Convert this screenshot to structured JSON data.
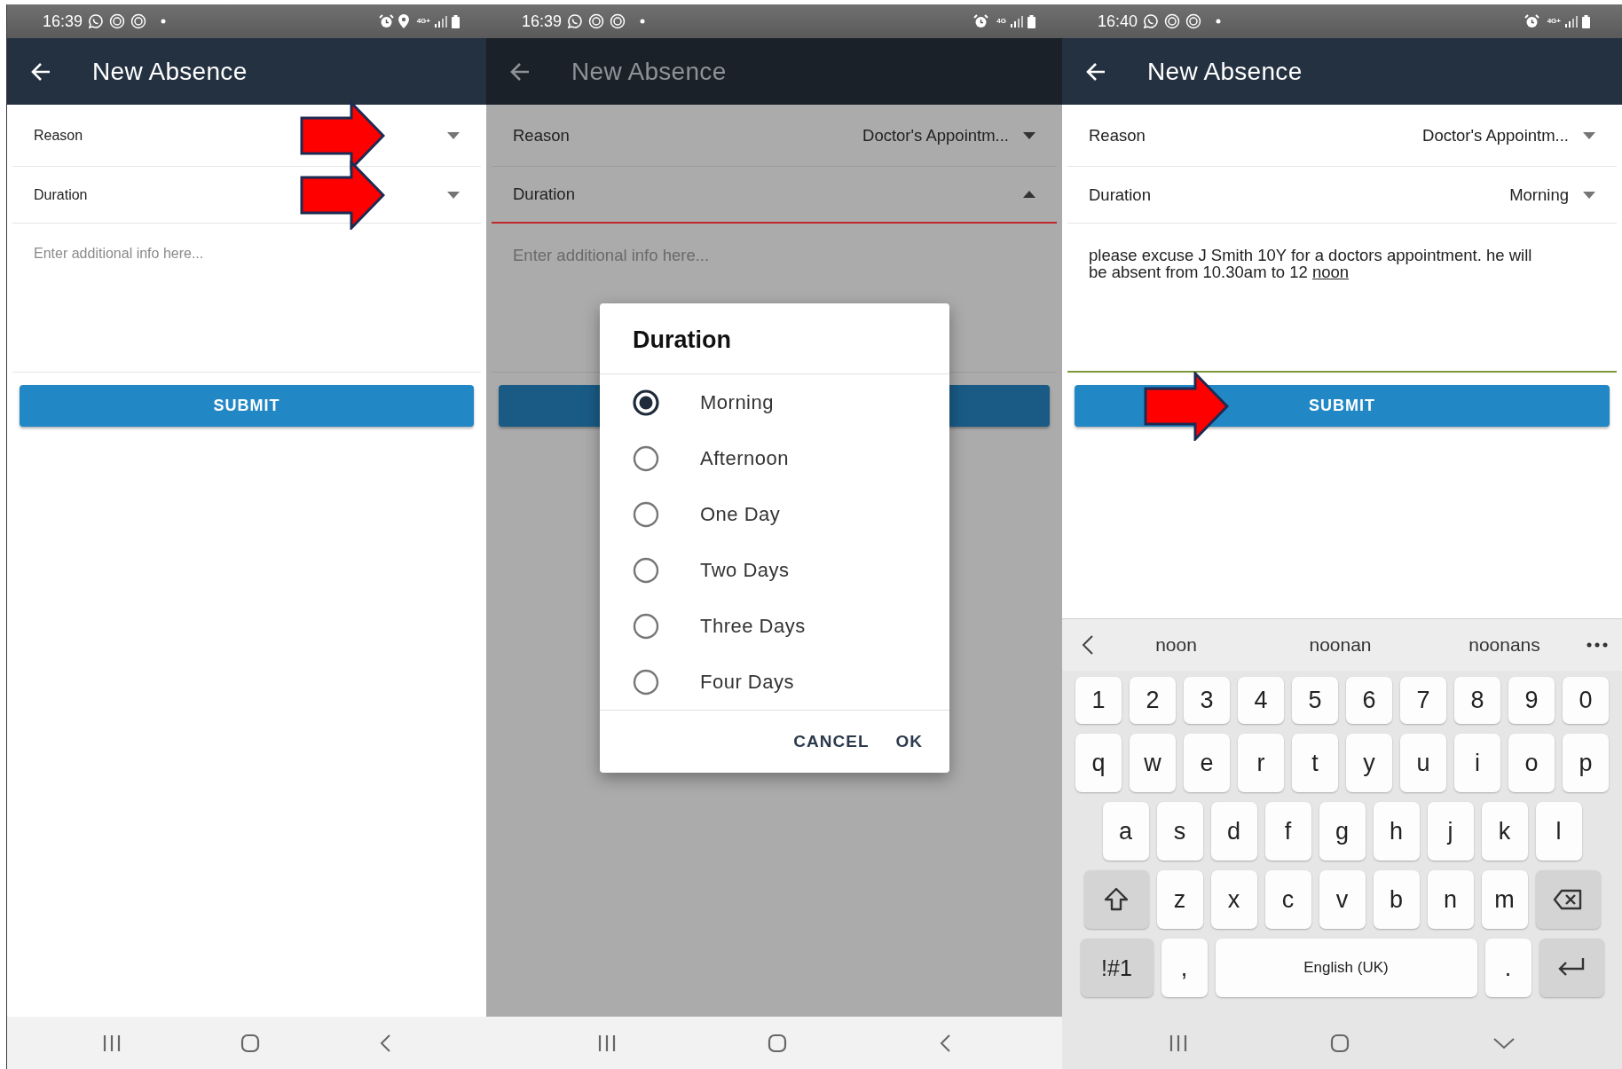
{
  "panels": [
    {
      "status_bar": {
        "time": "16:39",
        "location": true,
        "network": "4G+"
      },
      "header": {
        "title": "New Absence"
      },
      "fields": [
        {
          "label": "Reason",
          "expanded": false,
          "annotated": true
        },
        {
          "label": "Duration",
          "expanded": false,
          "annotated": true
        }
      ],
      "notes": {
        "placeholder": "Enter additional info here...",
        "focused": false
      },
      "submit": {
        "label": "SUBMIT",
        "annotated": false
      },
      "nav_bar": {
        "kind": "back"
      }
    },
    {
      "status_bar": {
        "time": "16:39",
        "location": false,
        "network": "4G"
      },
      "header": {
        "title": "New Absence"
      },
      "fields": [
        {
          "label": "Reason",
          "value": "Doctor's Appointm...",
          "expanded": false,
          "annotated": false
        },
        {
          "label": "Duration",
          "expanded": true,
          "annotated": false
        }
      ],
      "notes": {
        "placeholder": "Enter additional info here...",
        "focused": false
      },
      "submit": {
        "annotated": false
      },
      "dialog": {
        "title": "Duration",
        "options": [
          {
            "label": "Morning",
            "selected": true
          },
          {
            "label": "Afternoon",
            "selected": false
          },
          {
            "label": "One Day",
            "selected": false
          },
          {
            "label": "Two Days",
            "selected": false
          },
          {
            "label": "Three Days",
            "selected": false
          },
          {
            "label": "Four Days",
            "selected": false
          }
        ],
        "buttons": [
          "CANCEL",
          "OK"
        ]
      },
      "nav_bar": {
        "kind": "back"
      }
    },
    {
      "status_bar": {
        "time": "16:40",
        "location": false,
        "network": "4G+"
      },
      "header": {
        "title": "New Absence"
      },
      "fields": [
        {
          "label": "Reason",
          "value": "Doctor's Appointm...",
          "expanded": false,
          "annotated": false
        },
        {
          "label": "Duration",
          "value": "Morning",
          "expanded": false,
          "annotated": false
        }
      ],
      "notes": {
        "value": "please excuse J Smith 10Y for a doctors appointment. he will be absent from 10.30am to 12",
        "composing": "noon",
        "focused": true
      },
      "submit": {
        "label": "SUBMIT",
        "annotated": true
      },
      "keyboard": {
        "suggestions": [
          "noon",
          "noonan",
          "noonans"
        ],
        "rows": [
          {
            "keys": [
              {
                "kind": "char",
                "label": "1"
              },
              {
                "kind": "char",
                "label": "2"
              },
              {
                "kind": "char",
                "label": "3"
              },
              {
                "kind": "char",
                "label": "4"
              },
              {
                "kind": "char",
                "label": "5"
              },
              {
                "kind": "char",
                "label": "6"
              },
              {
                "kind": "char",
                "label": "7"
              },
              {
                "kind": "char",
                "label": "8"
              },
              {
                "kind": "char",
                "label": "9"
              },
              {
                "kind": "char",
                "label": "0"
              }
            ]
          },
          {
            "keys": [
              {
                "kind": "char",
                "label": "q"
              },
              {
                "kind": "char",
                "label": "w"
              },
              {
                "kind": "char",
                "label": "e"
              },
              {
                "kind": "char",
                "label": "r"
              },
              {
                "kind": "char",
                "label": "t"
              },
              {
                "kind": "char",
                "label": "y"
              },
              {
                "kind": "char",
                "label": "u"
              },
              {
                "kind": "char",
                "label": "i"
              },
              {
                "kind": "char",
                "label": "o"
              },
              {
                "kind": "char",
                "label": "p"
              }
            ]
          },
          {
            "keys": [
              {
                "kind": "char",
                "label": "a"
              },
              {
                "kind": "char",
                "label": "s"
              },
              {
                "kind": "char",
                "label": "d"
              },
              {
                "kind": "char",
                "label": "f"
              },
              {
                "kind": "char",
                "label": "g"
              },
              {
                "kind": "char",
                "label": "h"
              },
              {
                "kind": "char",
                "label": "j"
              },
              {
                "kind": "char",
                "label": "k"
              },
              {
                "kind": "char",
                "label": "l"
              }
            ]
          },
          {
            "keys": [
              {
                "kind": "shift"
              },
              {
                "kind": "char",
                "label": "z"
              },
              {
                "kind": "char",
                "label": "x"
              },
              {
                "kind": "char",
                "label": "c"
              },
              {
                "kind": "char",
                "label": "v"
              },
              {
                "kind": "char",
                "label": "b"
              },
              {
                "kind": "char",
                "label": "n"
              },
              {
                "kind": "char",
                "label": "m"
              },
              {
                "kind": "backspace"
              }
            ]
          },
          {
            "keys": [
              {
                "kind": "symbols",
                "label": "!#1"
              },
              {
                "kind": "char",
                "label": ","
              },
              {
                "kind": "space",
                "label": "English (UK)"
              },
              {
                "kind": "char",
                "label": "."
              },
              {
                "kind": "enter"
              }
            ]
          }
        ]
      },
      "nav_bar": {
        "kind": "hide_keyboard"
      }
    }
  ]
}
